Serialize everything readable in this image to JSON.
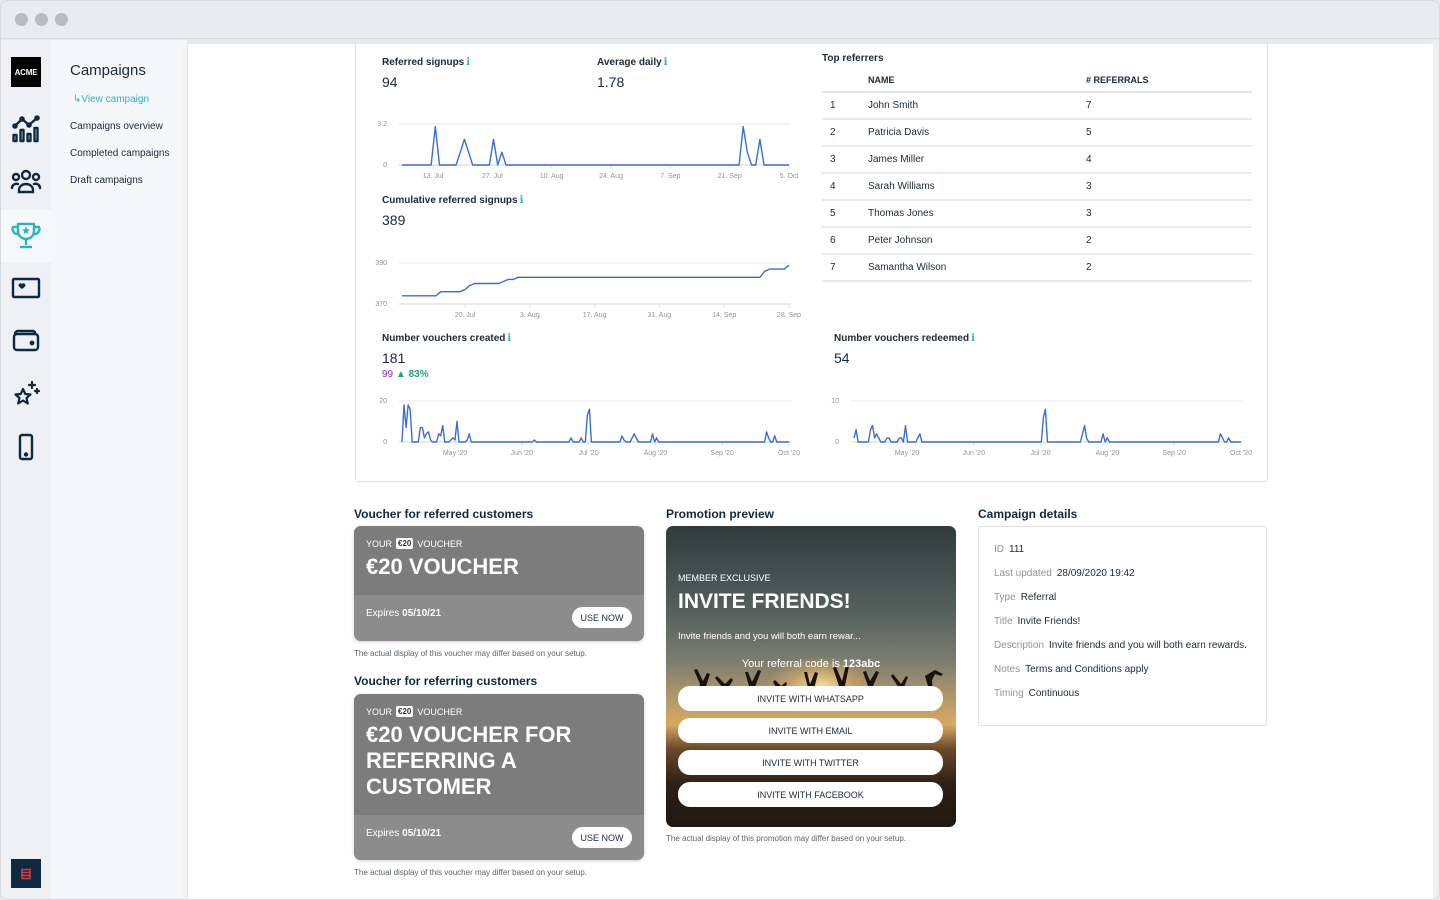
{
  "window": {
    "controls": [
      "close",
      "minimize",
      "maximize"
    ]
  },
  "rail": {
    "logo": "ACME",
    "items": [
      {
        "name": "analytics",
        "icon": "chart-icon",
        "active": false
      },
      {
        "name": "customers",
        "icon": "users-icon",
        "active": false
      },
      {
        "name": "campaigns",
        "icon": "trophy-icon",
        "active": true
      },
      {
        "name": "cards",
        "icon": "heart-card-icon",
        "active": false
      },
      {
        "name": "wallet",
        "icon": "wallet-icon",
        "active": false
      },
      {
        "name": "rewards",
        "icon": "sparkle-star-icon",
        "active": false
      },
      {
        "name": "mobile",
        "icon": "phone-icon",
        "active": false
      }
    ],
    "chat_icon": "chat-icon"
  },
  "subnav": {
    "title": "Campaigns",
    "current": "↳View campaign",
    "links": [
      "Campaigns overview",
      "Completed campaigns",
      "Draft campaigns"
    ]
  },
  "stats": {
    "referred_signups": {
      "label": "Referred signups",
      "value": "94"
    },
    "average_daily": {
      "label": "Average daily",
      "value": "1.78"
    },
    "cumulative": {
      "label": "Cumulative referred signups",
      "value": "389"
    },
    "vouchers_created": {
      "label": "Number vouchers created",
      "value": "181",
      "previous": "99",
      "change": "83%",
      "change_color": "#1ea672",
      "previous_color": "#8a2be2"
    },
    "vouchers_redeemed": {
      "label": "Number vouchers redeemed",
      "value": "54"
    },
    "info_glyph": "i"
  },
  "chart_data": [
    {
      "type": "line",
      "title": "Referred signups",
      "x": [
        "6 Jul",
        "7 Jul",
        "8 Jul",
        "9 Jul",
        "10 Jul",
        "11 Jul",
        "12 Jul",
        "13 Jul",
        "14 Jul",
        "15 Jul",
        "16 Jul",
        "17 Jul",
        "18 Jul",
        "19 Jul",
        "20 Jul",
        "21 Jul",
        "22 Jul",
        "23 Jul",
        "24 Jul",
        "25 Jul",
        "26 Jul",
        "27 Jul",
        "28 Jul",
        "29 Jul",
        "30 Jul",
        "31 Jul",
        "1 Aug",
        "2 Aug",
        "3 Aug",
        "4 Aug",
        "5 Aug",
        "6 Aug",
        "7 Aug",
        "8 Aug",
        "9 Aug",
        "10 Aug",
        "11 Aug",
        "12 Aug",
        "13 Aug",
        "14 Aug",
        "15 Aug",
        "16 Aug",
        "17 Aug",
        "18 Aug",
        "19 Aug",
        "20 Aug",
        "21 Aug",
        "22 Aug",
        "23 Aug",
        "24 Aug",
        "25 Aug",
        "26 Aug",
        "27 Aug",
        "28 Aug",
        "29 Aug",
        "30 Aug",
        "31 Aug",
        "1 Sep",
        "2 Sep",
        "3 Sep",
        "4 Sep",
        "5 Sep",
        "6 Sep",
        "7 Sep",
        "8 Sep",
        "9 Sep",
        "10 Sep",
        "11 Sep",
        "12 Sep",
        "13 Sep",
        "14 Sep",
        "15 Sep",
        "16 Sep",
        "17 Sep",
        "18 Sep",
        "19 Sep",
        "20 Sep",
        "21 Sep",
        "22 Sep",
        "23 Sep",
        "24 Sep",
        "25 Sep",
        "26 Sep",
        "27 Sep",
        "28 Sep",
        "29 Sep",
        "30 Sep",
        "1 Oct",
        "2 Oct",
        "3 Oct",
        "4 Oct",
        "5 Oct"
      ],
      "values": [
        0,
        0,
        0,
        0,
        0,
        0,
        0,
        0,
        3,
        0,
        0,
        0,
        0,
        0,
        1,
        2,
        1,
        0,
        0,
        0,
        0,
        0,
        2,
        0,
        1,
        0,
        0,
        0,
        0,
        0,
        0,
        0,
        0,
        0,
        0,
        0,
        0,
        0,
        0,
        0,
        0,
        0,
        0,
        0,
        0,
        0,
        0,
        0,
        0,
        0,
        0,
        0,
        0,
        0,
        0,
        0,
        0,
        0,
        0,
        0,
        0,
        0,
        0,
        0,
        0,
        0,
        0,
        0,
        0,
        0,
        0,
        0,
        0,
        0,
        0,
        0,
        0,
        0,
        0,
        0,
        0,
        0,
        3,
        1,
        0,
        0,
        2,
        0,
        0,
        0,
        0,
        0,
        0,
        0
      ],
      "yticks": [
        "0",
        "3.2"
      ],
      "ylim": [
        0,
        3.2
      ],
      "xticks": [
        "13. Jul",
        "27. Jul",
        "10. Aug",
        "24. Aug",
        "7. Sep",
        "21. Sep",
        "5. Oct"
      ],
      "grid": true
    },
    {
      "type": "line",
      "title": "Cumulative referred signups",
      "x_span": [
        "10 Jul",
        "29 Sep"
      ],
      "values": [
        374,
        374,
        374,
        374,
        374,
        374,
        374,
        374,
        376,
        376,
        376,
        376,
        376,
        377,
        379,
        380,
        380,
        380,
        380,
        380,
        380,
        381,
        382,
        382,
        383,
        383,
        383,
        383,
        383,
        383,
        383,
        383,
        383,
        383,
        383,
        383,
        383,
        383,
        383,
        383,
        383,
        383,
        383,
        383,
        383,
        383,
        383,
        383,
        383,
        383,
        383,
        383,
        383,
        383,
        383,
        383,
        383,
        383,
        383,
        383,
        383,
        383,
        383,
        383,
        383,
        383,
        383,
        383,
        383,
        383,
        383,
        383,
        383,
        383,
        383,
        386,
        387,
        387,
        387,
        387,
        389
      ],
      "yticks": [
        "370",
        "390"
      ],
      "ylim": [
        370,
        390
      ],
      "xticks": [
        "20. Jul",
        "3. Aug",
        "17. Aug",
        "31. Aug",
        "14. Sep",
        "28. Sep"
      ],
      "grid": true
    },
    {
      "type": "line",
      "title": "Number vouchers created",
      "x_span": [
        "Apr '20",
        "Oct '20"
      ],
      "values": [
        0,
        18,
        7,
        18,
        16,
        0,
        0,
        0,
        0,
        7,
        7,
        2,
        4,
        5,
        1,
        0,
        0,
        0,
        4,
        3,
        8,
        0,
        0,
        0,
        1,
        2,
        1,
        10,
        0,
        0,
        0,
        0,
        1,
        4,
        0,
        0,
        0,
        0,
        0,
        0,
        0,
        0,
        0,
        0,
        0,
        0,
        0,
        0,
        0,
        0,
        0,
        0,
        0,
        0,
        0,
        0,
        0,
        0,
        0,
        0,
        0,
        0,
        0,
        0,
        0,
        1,
        0,
        0,
        0,
        0,
        0,
        0,
        0,
        0,
        0,
        0,
        0,
        0,
        0,
        0,
        0,
        0,
        0,
        2,
        0,
        0,
        0,
        0,
        2,
        0,
        0,
        13,
        16,
        0,
        0,
        0,
        0,
        0,
        0,
        0,
        0,
        0,
        0,
        0,
        0,
        0,
        0,
        0,
        3,
        1,
        0,
        0,
        0,
        2,
        4,
        2,
        0,
        0,
        0,
        0,
        0,
        0,
        0,
        4,
        0,
        2,
        0,
        0,
        0,
        0,
        0,
        0,
        0,
        0,
        0,
        0,
        0,
        0,
        0,
        0,
        0,
        0,
        0,
        0,
        0,
        0,
        0,
        0,
        0,
        0,
        0,
        0,
        0,
        0,
        0,
        0,
        0,
        0,
        0,
        0,
        0,
        0,
        0,
        0,
        0,
        0,
        0,
        0,
        0,
        0,
        0,
        0,
        0,
        0,
        0,
        0,
        0,
        0,
        0,
        5,
        2,
        0,
        0,
        3,
        0,
        0,
        0,
        0,
        0,
        0,
        0
      ],
      "yticks": [
        "0",
        "20"
      ],
      "ylim": [
        0,
        20
      ],
      "xticks": [
        "May '20",
        "Jun '20",
        "Jul '20",
        "Aug '20",
        "Sep '20",
        "Oct '20"
      ],
      "grid": true
    },
    {
      "type": "line",
      "title": "Number vouchers redeemed",
      "x_span": [
        "Apr '20",
        "Oct '20"
      ],
      "values": [
        1,
        3,
        0,
        0,
        0,
        0,
        0,
        0,
        3,
        4,
        1,
        2,
        1,
        0,
        0,
        0,
        1,
        1,
        0,
        0,
        0,
        0,
        1,
        1,
        0,
        4,
        0,
        0,
        0,
        0,
        0,
        1,
        2,
        0,
        0,
        0,
        0,
        0,
        0,
        0,
        0,
        0,
        0,
        0,
        0,
        0,
        0,
        0,
        0,
        0,
        0,
        0,
        0,
        0,
        0,
        0,
        0,
        0,
        0,
        0,
        0,
        0,
        0,
        0,
        0,
        0,
        0,
        0,
        0,
        0,
        0,
        0,
        0,
        0,
        0,
        0,
        0,
        0,
        0,
        0,
        0,
        0,
        0,
        0,
        0,
        0,
        0,
        0,
        0,
        0,
        0,
        0,
        6,
        8,
        0,
        0,
        0,
        0,
        0,
        0,
        0,
        0,
        0,
        0,
        0,
        0,
        0,
        0,
        0,
        0,
        0,
        2,
        4,
        1,
        0,
        0,
        0,
        0,
        0,
        0,
        0,
        2,
        0,
        1,
        0,
        0,
        0,
        0,
        0,
        0,
        0,
        0,
        0,
        0,
        0,
        0,
        0,
        0,
        0,
        0,
        0,
        0,
        0,
        0,
        0,
        0,
        0,
        0,
        0,
        0,
        0,
        0,
        0,
        0,
        0,
        0,
        0,
        0,
        0,
        0,
        0,
        0,
        0,
        0,
        0,
        0,
        0,
        0,
        0,
        0,
        0,
        0,
        0,
        0,
        0,
        0,
        0,
        0,
        2,
        1,
        0,
        0,
        1,
        0,
        0,
        0,
        0,
        0,
        0
      ],
      "yticks": [
        "0",
        "10"
      ],
      "ylim": [
        0,
        10
      ],
      "xticks": [
        "May '20",
        "Jun '20",
        "Jul '20",
        "Aug '20",
        "Sep '20",
        "Oct '20"
      ],
      "grid": true
    }
  ],
  "top_referrers": {
    "title": "Top referrers",
    "columns": [
      "",
      "NAME",
      "# REFERRALS"
    ],
    "rows": [
      {
        "rank": "1",
        "name": "John Smith",
        "referrals": "7"
      },
      {
        "rank": "2",
        "name": "Patricia Davis",
        "referrals": "5"
      },
      {
        "rank": "3",
        "name": "James Miller",
        "referrals": "4"
      },
      {
        "rank": "4",
        "name": "Sarah Williams",
        "referrals": "3"
      },
      {
        "rank": "5",
        "name": "Thomas Jones",
        "referrals": "3"
      },
      {
        "rank": "6",
        "name": "Peter Johnson",
        "referrals": "2"
      },
      {
        "rank": "7",
        "name": "Samantha Wilson",
        "referrals": "2"
      }
    ]
  },
  "voucher_referred": {
    "section_title": "Voucher for referred customers",
    "pre_left": "YOUR",
    "pill": "€20",
    "pre_right": "VOUCHER",
    "headline": "€20 VOUCHER",
    "expires_label": "Expires",
    "expires_date": "05/10/21",
    "button": "USE NOW",
    "disclaimer": "The actual display of this voucher may differ based on your setup."
  },
  "voucher_referring": {
    "section_title": "Voucher for referring customers",
    "pre_left": "YOUR",
    "pill": "€20",
    "pre_right": "VOUCHER",
    "headline": "€20 VOUCHER FOR REFERRING A CUSTOMER",
    "expires_label": "Expires",
    "expires_date": "05/10/21",
    "button": "USE NOW",
    "disclaimer": "The actual display of this voucher may differ based on your setup."
  },
  "promotion": {
    "section_title": "Promotion preview",
    "eyebrow": "MEMBER EXCLUSIVE",
    "headline": "INVITE FRIENDS!",
    "description": "Invite friends and you will both earn rewar...",
    "code_prefix": "Your referral code is",
    "code": "123abc",
    "buttons": [
      "INVITE WITH WHATSAPP",
      "INVITE WITH EMAIL",
      "INVITE WITH TWITTER",
      "INVITE WITH FACEBOOK"
    ],
    "disclaimer": "The actual display of this promotion may differ based on your setup."
  },
  "campaign_details": {
    "section_title": "Campaign details",
    "rows": [
      {
        "key": "ID",
        "value": "111"
      },
      {
        "key": "Last updated",
        "value": "28/09/2020 19:42"
      },
      {
        "key": "Type",
        "value": "Referral"
      },
      {
        "key": "Title",
        "value": "Invite Friends!"
      },
      {
        "key": "Description",
        "value": "Invite friends and you will both earn rewards."
      },
      {
        "key": "Notes",
        "value": "Terms and Conditions apply"
      },
      {
        "key": "Timing",
        "value": "Continuous"
      }
    ]
  },
  "colors": {
    "accent": "#2bb3c0",
    "line": "#3a6fd1",
    "navy": "#0e2a40",
    "voucher_bg": "#7c7c7c"
  }
}
